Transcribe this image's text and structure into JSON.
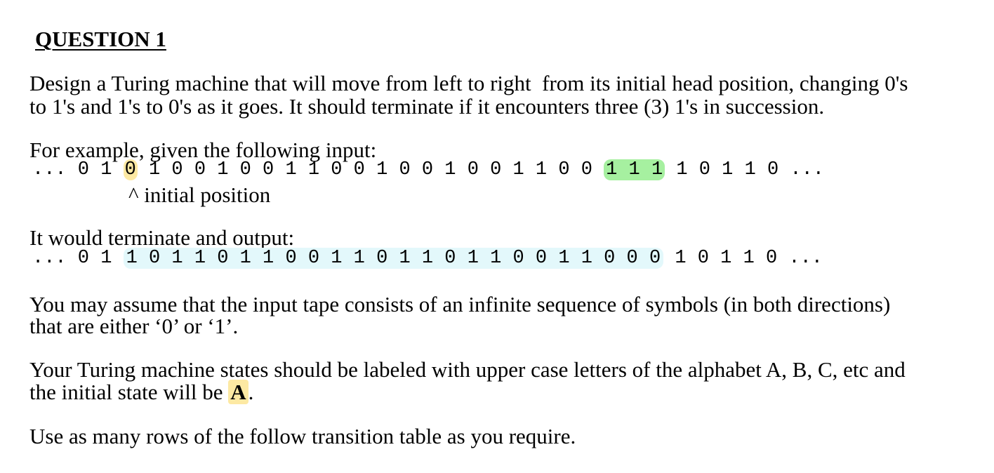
{
  "title": "QUESTION 1",
  "intro": {
    "line1": "Design a Turing machine that will move from left to right  from its initial head position, changing 0's",
    "line2": "to 1's and 1's to 0's as it goes. It should terminate if it encounters three (3) 1's in succession."
  },
  "example": {
    "label": "For example, given the following input:",
    "tape_prefix": "... 0 1 ",
    "tape_head": "0",
    "tape_middle": " 1 0 0 1 0 0 1 1 0 0 1 0 0 1 0 0 1 1 0 0 ",
    "tape_highlight": "1 1 1",
    "tape_suffix": " 1 0 1 1 0 ...",
    "caret": "^ initial position"
  },
  "output": {
    "label": "It would terminate and output:",
    "tape_prefix": "... 0 1 ",
    "tape_changed": "1 0 1 1 0 1 1 0 0 1 1 0 1 1 0 1 1 0 0 1 1 0 0 0",
    "tape_suffix": " 1 0 1 1 0 ..."
  },
  "assume": {
    "line1": "You may assume that the input tape consists of an infinite sequence of symbols (in both directions)",
    "line2": "that are either ‘0’ or ‘1’."
  },
  "states": {
    "line1": "Your Turing machine states should be labeled with upper case letters of the alphabet A, B, C, etc and",
    "line2_prefix": "the initial state will be ",
    "line2_state": "A",
    "line2_suffix": "."
  },
  "rows_note": "Use as many rows of the follow transition table as you require.",
  "colors": {
    "head_highlight": "#fde9a3",
    "terminate_highlight": "#a6f0a0",
    "changed_highlight": "#e3f8fb"
  }
}
